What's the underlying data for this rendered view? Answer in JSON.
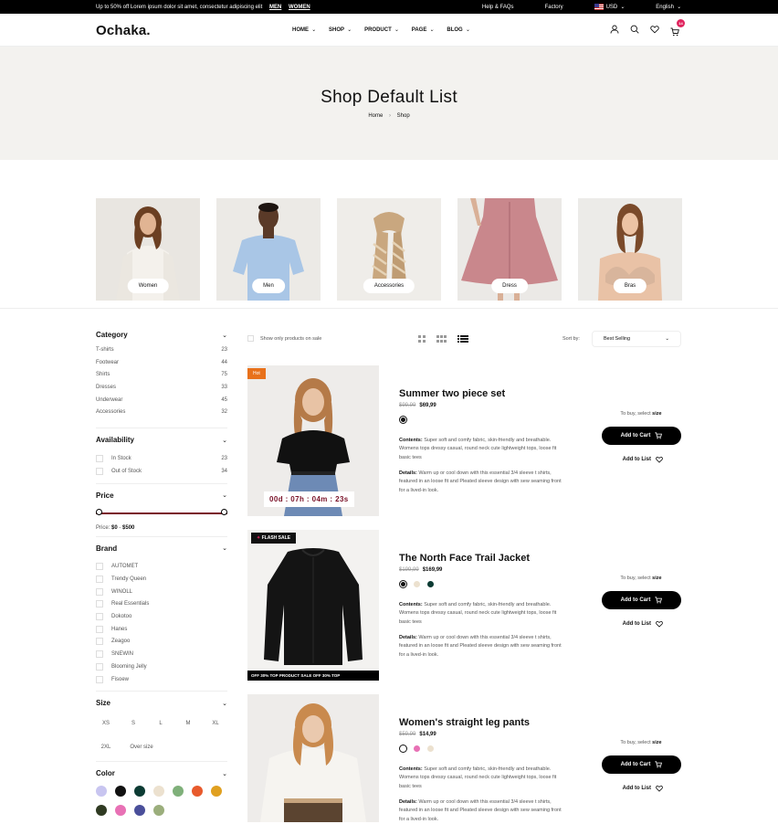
{
  "topbar": {
    "promo": "Up to 50% off Lorem ipsum dolor sit amet, consectetur adipiscing elit",
    "link_men": "MEN",
    "link_women": "WOMEN",
    "help": "Help & FAQs",
    "factory": "Factory",
    "currency": "USD",
    "language": "English"
  },
  "header": {
    "logo": "Ochaka.",
    "nav": [
      "HOME",
      "SHOP",
      "PRODUCT",
      "PAGE",
      "BLOG"
    ],
    "cart_count": "14"
  },
  "hero": {
    "title": "Shop Default List",
    "breadcrumb_home": "Home",
    "breadcrumb_current": "Shop"
  },
  "categories": [
    "Women",
    "Men",
    "Accessories",
    "Dress",
    "Bras"
  ],
  "sidebar": {
    "category_title": "Category",
    "categories": [
      {
        "label": "T-shirts",
        "count": "23"
      },
      {
        "label": "Footwear",
        "count": "44"
      },
      {
        "label": "Shirts",
        "count": "75"
      },
      {
        "label": "Dresses",
        "count": "33"
      },
      {
        "label": "Underwear",
        "count": "45"
      },
      {
        "label": "Accessories",
        "count": "32"
      }
    ],
    "availability_title": "Availability",
    "availability": [
      {
        "label": "In Stock",
        "count": "23"
      },
      {
        "label": "Out of Stock",
        "count": "34"
      }
    ],
    "price_title": "Price",
    "price_label": "Price:",
    "price_min": "$0",
    "price_sep": "-",
    "price_max": "$500",
    "brand_title": "Brand",
    "brands": [
      "AUTOMET",
      "Trendy Queen",
      "WINOLL",
      "Real Essentials",
      "Dokotoo",
      "Hanes",
      "Zeagoo",
      "SNEWIN",
      "Blooming Jelly",
      "Fisoew"
    ],
    "size_title": "Size",
    "sizes": [
      "XS",
      "S",
      "L",
      "M",
      "XL",
      "2XL",
      "Over size"
    ],
    "color_title": "Color",
    "colors": [
      "#c8c5f0",
      "#111111",
      "#0c3b33",
      "#ece1cf",
      "#7fb07a",
      "#e85a2c",
      "#e0a020",
      "#2f3a22",
      "#e871b5",
      "#4a4f9a",
      "#9bae7c"
    ]
  },
  "toolbar": {
    "sale_only": "Show only products on sale",
    "sort_label": "Sort by:",
    "sort_value": "Best Selling"
  },
  "products": [
    {
      "title": "Summer two piece set",
      "old_price": "$99,99",
      "price": "$69,99",
      "tag": "Hot",
      "countdown": "00d : 07h : 04m : 23s",
      "colors": [
        "#111111"
      ],
      "contents_label": "Contents:",
      "contents": "Super soft and comfy fabric, skin-friendly and breathable. Womens tops dressy casual, round neck cute lightweight tops, loose fit basic tees",
      "details_label": "Details:",
      "details": "Warm up or cool down with this essential 3/4 sleeve t shirts, featured in an loose fit and Pleated sleeve design with sew seaming front for a lived-in look.",
      "buy_note": "To buy, select",
      "buy_note_bold": "size",
      "add_to_cart": "Add to Cart",
      "add_to_list": "Add to List"
    },
    {
      "title": "The North Face Trail Jacket",
      "old_price": "$199,99",
      "price": "$169,99",
      "tag": "FLASH SALE",
      "ticker": "OFF 30%    TOP PRODUCT SALE OFF 30%    TOP",
      "colors": [
        "#111111",
        "#ece1cf",
        "#0c3b33"
      ],
      "contents_label": "Contents:",
      "contents": "Super soft and comfy fabric, skin-friendly and breathable. Womens tops dressy casual, round neck cute lightweight tops, loose fit basic tees",
      "details_label": "Details:",
      "details": "Warm up or cool down with this essential 3/4 sleeve t shirts, featured in an loose fit and Pleated sleeve design with sew seaming front for a lived-in look.",
      "buy_note": "To buy, select",
      "buy_note_bold": "size",
      "add_to_cart": "Add to Cart",
      "add_to_list": "Add to List"
    },
    {
      "title": "Women's straight leg pants",
      "old_price": "$59,99",
      "price": "$14,99",
      "colors": [
        "#ffffff",
        "#e871b5",
        "#ece1cf"
      ],
      "contents_label": "Contents:",
      "contents": "Super soft and comfy fabric, skin-friendly and breathable. Womens tops dressy casual, round neck cute lightweight tops, loose fit basic tees",
      "details_label": "Details:",
      "details": "Warm up or cool down with this essential 3/4 sleeve t shirts, featured in an loose fit and Pleated sleeve design with sew seaming front for a lived-in look.",
      "buy_note": "To buy, select",
      "buy_note_bold": "size",
      "add_to_cart": "Add to Cart",
      "add_to_list": "Add to List"
    }
  ],
  "accent": {
    "hot": "#e8711b",
    "price_track": "#7a1228",
    "badge": "#e0245e"
  }
}
